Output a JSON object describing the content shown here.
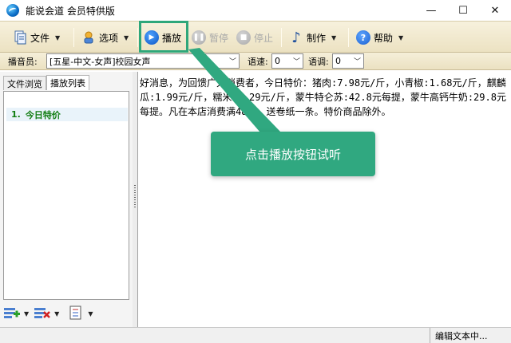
{
  "window": {
    "title": "能说会道 会员特供版",
    "controls": [
      "—",
      "☐",
      "✕"
    ]
  },
  "toolbar": {
    "file_label": "文件",
    "options_label": "选项",
    "play_label": "播放",
    "pause_label": "暂停",
    "stop_label": "停止",
    "make_label": "制作",
    "help_label": "帮助",
    "icons": {
      "file": "document-icon",
      "options": "hand-settings-icon",
      "play": "play-icon",
      "pause": "pause-icon",
      "stop": "stop-icon",
      "make": "music-note-icon",
      "help": "help-icon"
    },
    "highlight_color": "#2ea77a"
  },
  "settings": {
    "announcer_label": "播音员:",
    "announcer_value": "[五星-中文-女声]校园女声",
    "speed_label": "语速:",
    "speed_value": "0",
    "pitch_label": "语调:",
    "pitch_value": "0"
  },
  "left_pane": {
    "tabs": [
      "文件浏览",
      "播放列表"
    ],
    "active_tab": "播放列表",
    "items": [
      {
        "index": "1.",
        "label": "今日特价"
      }
    ],
    "bottom_icons": [
      "add-list-icon",
      "delete-list-icon",
      "list-edit-icon"
    ]
  },
  "editor": {
    "text": "好消息，为回馈广大消费者，今日特价：猪肉:7.98元/斤，小青椒:1.68元/斤，麒麟瓜:1.99元/斤，糯米:2.29元/斤，蒙牛特仑苏:42.8元每提，蒙牛高钙牛奶:29.8元每提。凡在本店消费满48元，送卷纸一条。特价商品除外。"
  },
  "callout": {
    "text": "点击播放按钮试听",
    "color": "#30a880"
  },
  "statusbar": {
    "text": "编辑文本中..."
  }
}
